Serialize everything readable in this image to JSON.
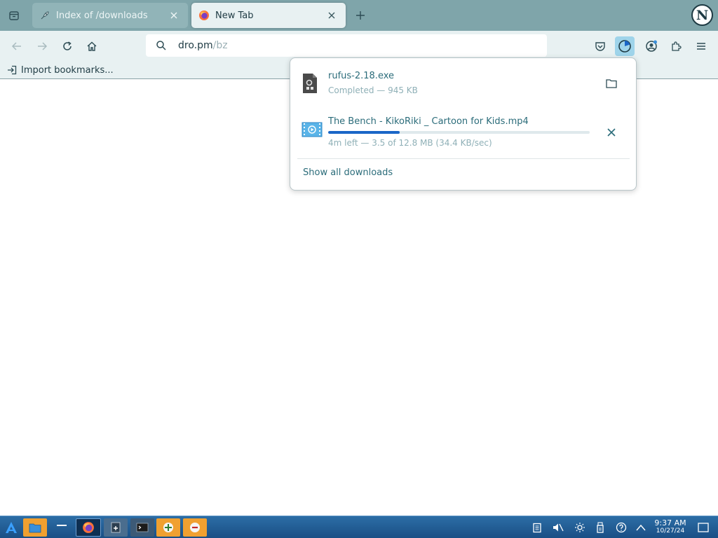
{
  "tabs": [
    {
      "title": "Index of /downloads",
      "active": false
    },
    {
      "title": "New Tab",
      "active": true
    }
  ],
  "navbar": {
    "url_host": "dro.pm",
    "url_path": "/bz"
  },
  "bookmarks": {
    "import_label": "Import bookmarks..."
  },
  "downloads": {
    "items": [
      {
        "name": "rufus-2.18.exe",
        "status": "Completed — 945 KB",
        "icon": "executable-file-icon",
        "action": "folder-icon"
      },
      {
        "name": "The Bench - KikoRiki _ Cartoon for Kids.mp4",
        "status": "4m left — 3.5 of 12.8 MB (34.4 KB/sec)",
        "progress": 0.273,
        "icon": "video-file-icon",
        "action": "close-icon"
      }
    ],
    "show_all_label": "Show all downloads"
  },
  "taskbar": {
    "time": "9:37 AM",
    "date": "10/27/24"
  },
  "colors": {
    "tabstrip": "#7fa5aa",
    "toolbar": "#e8f1f2",
    "accent": "#2b6c7a",
    "progress": "#1a66c7",
    "taskbar": "#1f5a92"
  }
}
